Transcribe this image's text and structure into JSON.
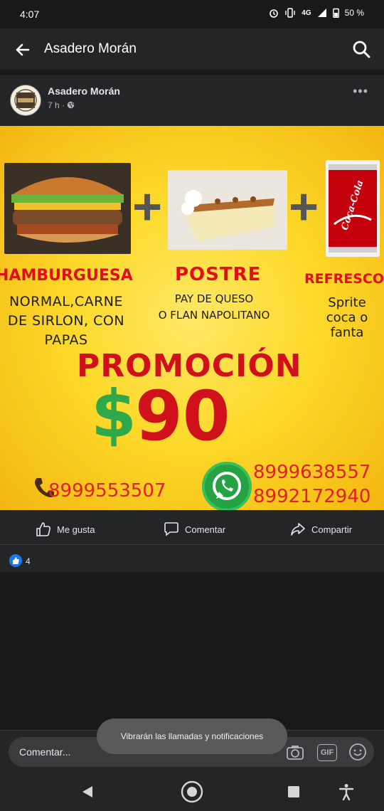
{
  "status_bar": {
    "time": "4:07",
    "network": "4G",
    "battery": "50 %"
  },
  "app_bar": {
    "title": "Asadero Morán",
    "back_icon": "arrow-left-icon",
    "search_icon": "search-icon"
  },
  "post": {
    "author": "Asadero Morán",
    "time": "7 h",
    "more_icon": "more-horizontal-icon",
    "image": {
      "col1_title": "HAMBURGUESA",
      "col1_text": [
        "NORMAL,CARNE",
        "DE SIRLON, CON",
        "PAPAS"
      ],
      "col2_title": "POSTRE",
      "col2_text": [
        "PAY DE QUESO",
        "O FLAN NAPOLITANO"
      ],
      "col3_title": "REFRESCO",
      "col3_text": [
        "Sprite",
        "coca o",
        "fanta"
      ],
      "coke_label": "Coca-Cola",
      "plus": "+",
      "promo_title": "PROMOCIÓN",
      "currency": "$",
      "price": "90",
      "phone_1": "8999553507",
      "phone_2": "8999638557",
      "phone_3": "8992172940"
    },
    "actions": {
      "like": "Me gusta",
      "comment": "Comentar",
      "share": "Compartir"
    },
    "reaction_count": "4"
  },
  "comment_bar": {
    "placeholder": "Comentar...",
    "gif_label": "GIF"
  },
  "toast": "Vibrarán las llamadas y notificaciones",
  "colors": {
    "background": "#18191a",
    "surface": "#242526",
    "promo_yellow": "#fdd92a",
    "promo_red": "#d0101a",
    "promo_green": "#2ea84a",
    "accent_blue": "#1877f2"
  }
}
